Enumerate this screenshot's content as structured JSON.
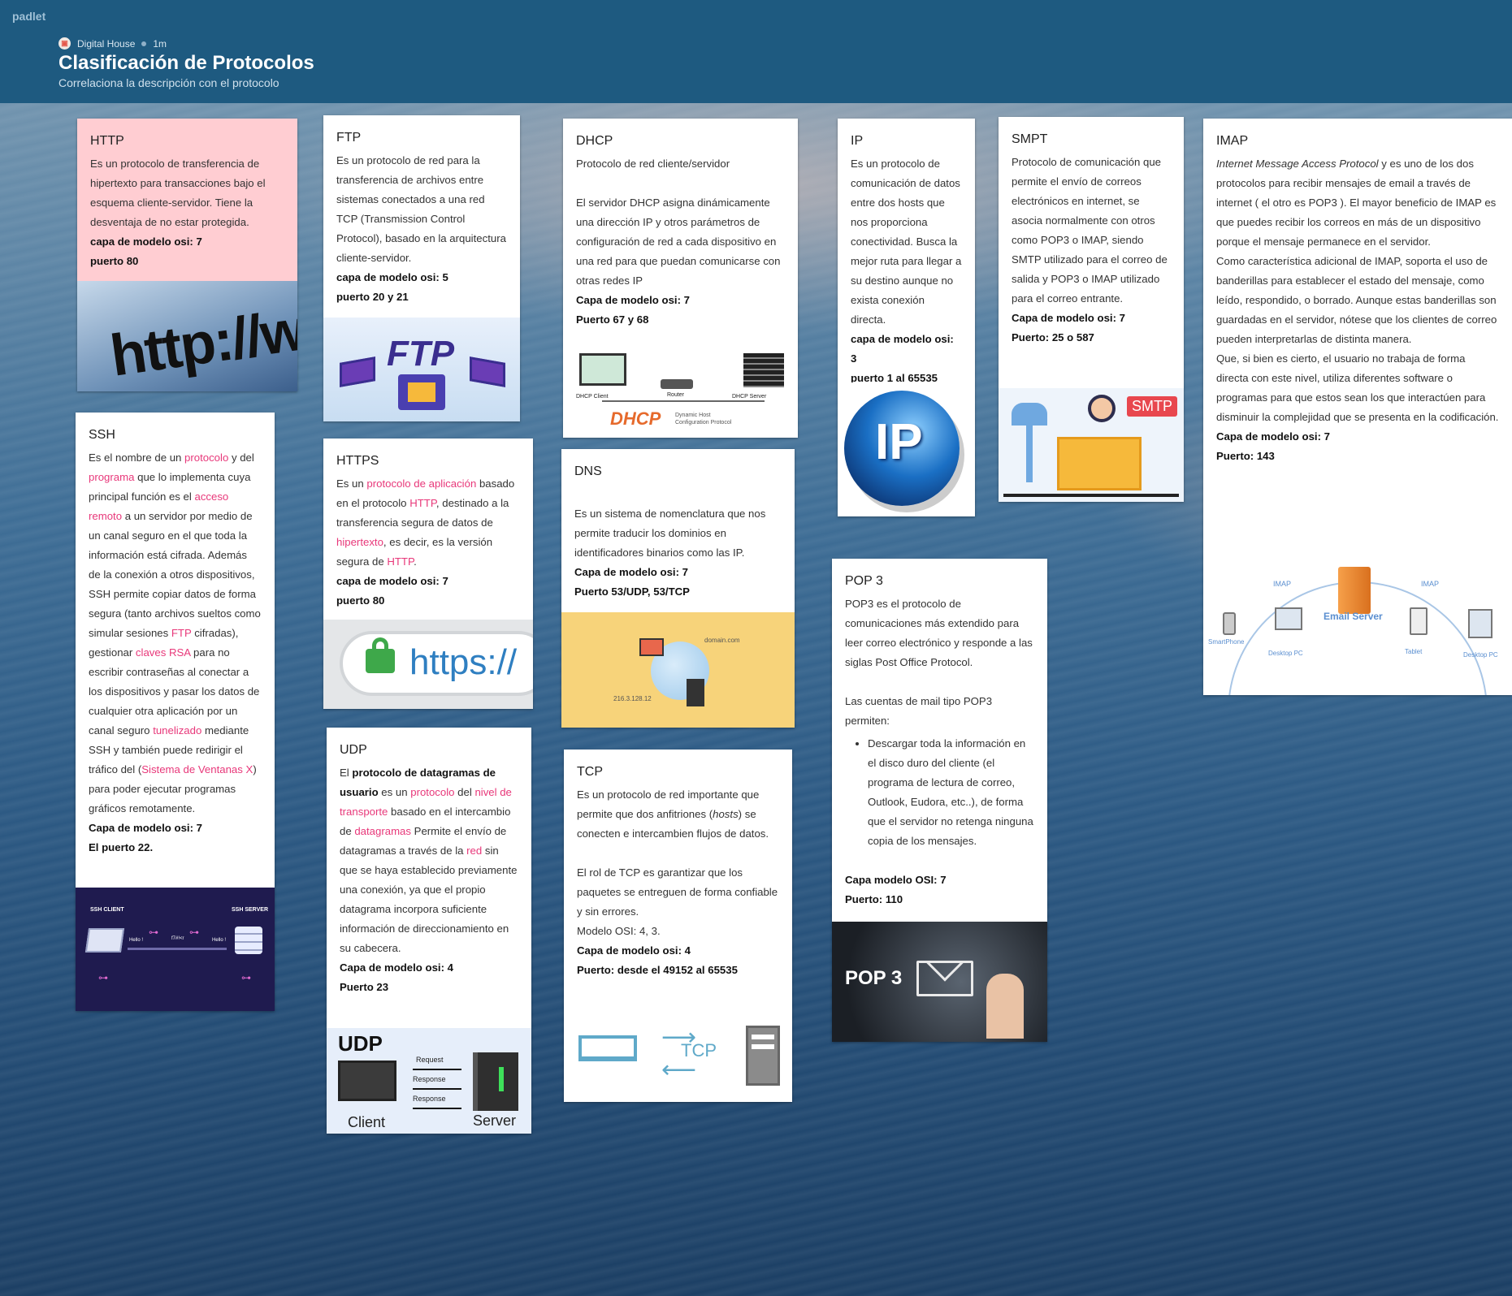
{
  "app": "padlet",
  "header": {
    "author": "Digital House",
    "time": "1m",
    "title": "Clasificación de Protocolos",
    "subtitle": "Correlaciona la descripción con el protocolo"
  },
  "cards": {
    "http": {
      "title": "HTTP",
      "text": "Es un protocolo de transferencia de hipertexto para transacciones bajo el esquema cliente-servidor. Tiene la desventaja de no estar protegida.",
      "layer": "capa de modelo osi: 7",
      "port": "puerto 80",
      "img": "http://www"
    },
    "ftp": {
      "title": "FTP",
      "text": "Es un protocolo de red para la transferencia de archivos entre sistemas conectados a una red TCP (Transmission Control Protocol), basado en la arquitectura cliente-servidor.",
      "layer": "capa de modelo osi: 5",
      "port": "puerto 20 y 21",
      "img": "FTP"
    },
    "dhcp": {
      "title": "DHCP",
      "p1": "Protocolo de red cliente/servidor",
      "p2": "El servidor DHCP asigna dinámicamente una dirección IP y otros parámetros de configuración de red a cada dispositivo en una red para que puedan comunicarse con otras redes IP",
      "layer": "Capa de modelo osi: 7",
      "port": "Puerto 67 y 68",
      "img_logo": "DHCP",
      "img_sub": "Dynamic Host Configuration Protocol",
      "img_client": "DHCP Client",
      "img_router": "Router",
      "img_server": "DHCP Server"
    },
    "ip": {
      "title": "IP",
      "text": "Es un protocolo de comunicación de datos entre dos hosts que nos proporciona conectividad. Busca la mejor ruta para llegar a su destino aunque no exista conexión directa.",
      "layer": "capa de modelo osi: 3",
      "port": "puerto 1 al 65535",
      "img": "IP"
    },
    "smpt": {
      "title": "SMPT",
      "text": "Protocolo de comunicación que permite el envío de correos electrónicos en internet,  se asocia normalmente con otros como POP3 o IMAP, siendo SMTP utilizado para el correo de salida y POP3 o IMAP utilizado para el correo entrante.",
      "layer": "Capa de modelo osi: 7",
      "port": "Puerto: 25 o 587",
      "img": "SMTP"
    },
    "imap": {
      "title": "IMAP",
      "em": "Internet Message Access Protocol",
      "p1": " y es uno de los dos protocolos para recibir mensajes de email a través de internet ( el otro es POP3 ). El mayor beneficio de IMAP es que puedes recibir los correos en más de un dispositivo porque el mensaje permanece en el servidor.",
      "p2": "Como característica adicional de IMAP, soporta el uso de banderillas para establecer el estado del mensaje, como leído, respondido, o borrado. Aunque estas banderillas son guardadas en el servidor, nótese que los clientes de correo pueden interpretarlas de distinta manera.",
      "p3": "Que, si bien es cierto, el usuario no trabaja de forma directa con este nivel, utiliza diferentes software o programas para que estos sean los que interactúen para disminuir la complejidad que se presenta en la codificación.",
      "layer": "Capa de modelo osi: 7",
      "port": "Puerto: 143",
      "img_server": "Email Server",
      "img_imap": "IMAP",
      "img_phone": "SmartPhone",
      "img_pc": "Desktop PC",
      "img_tablet": "Tablet"
    },
    "ssh": {
      "title": "SSH",
      "t1": "Es el nombre de un ",
      "l1": "protocolo",
      "t2": " y del ",
      "l2": "programa",
      "t3": " que lo implementa cuya principal función es el ",
      "l3": "acceso remoto",
      "t4": " a un servidor por medio de un canal seguro en el que toda la información está cifrada. Además de la conexión a otros dispositivos, SSH permite copiar datos de forma segura (tanto archivos sueltos como simular sesiones ",
      "l4": "FTP",
      "t5": " cifradas), gestionar ",
      "l5": "claves RSA",
      "t6": " para no escribir contraseñas al conectar a los dispositivos y pasar los datos de cualquier otra aplicación por un canal seguro ",
      "l6": "tunelizado",
      "t7": " mediante SSH y también puede redirigir el tráfico del (",
      "l7": "Sistema de Ventanas X",
      "t8": ") para poder ejecutar programas gráficos remotamente.",
      "layer": "Capa de modelo osi: 7",
      "port": "El puerto 22.",
      "img_client": "SSH CLIENT",
      "img_server": "SSH SERVER",
      "img_hello": "Hello !",
      "img_enc": "f7#!<r"
    },
    "https": {
      "title": "HTTPS",
      "t1": "Es un ",
      "l1": "protocolo de aplicación",
      "t2": " basado en el protocolo ",
      "l2": "HTTP",
      "t3": ", destinado a la transferencia segura de datos de ",
      "l3": "hipertexto",
      "t4": ", es decir, es la versión segura de ",
      "l4": "HTTP",
      "t5": ".",
      "layer": "capa de modelo osi: 7",
      "port": "puerto 80",
      "img": "https://"
    },
    "dns": {
      "title": "DNS",
      "text": "Es un sistema de nomenclatura que nos permite traducir los dominios en identificadores binarios como las IP.",
      "layer": "Capa de modelo osi: 7",
      "port": "Puerto 53/UDP, 53/TCP",
      "img_domain": "domain.com",
      "img_ip": "216.3.128.12"
    },
    "udp": {
      "title": "UDP",
      "t1": "El ",
      "b1": "protocolo de datagramas de usuario",
      "t2": "  es un ",
      "l1": "protocolo",
      "t3": " del ",
      "l2": "nivel de transporte",
      "t4": " basado en el intercambio de ",
      "l3": "datagramas",
      "t5": " Permite el envío de datagramas a través de la ",
      "l4": "red",
      "t6": " sin que se haya establecido previamente una conexión, ya que el propio datagrama incorpora suficiente información de direccionamiento en su cabecera.",
      "layer": "Capa de modelo osi: 4",
      "port": "Puerto 23",
      "img_title": "UDP",
      "img_req": "Request",
      "img_res": "Response",
      "img_client": "Client",
      "img_server": "Server"
    },
    "tcp": {
      "title": "TCP",
      "t1": "Es un protocolo de red importante que permite que dos anfitriones (",
      "em": "hosts",
      "t2": ") se conecten e intercambien flujos de datos.",
      "p2": "El rol de TCP es garantizar que los paquetes se entreguen de forma confiable y sin errores.",
      "p3": "Modelo OSI: 4, 3.",
      "layer": "Capa de modelo osi: 4",
      "port": "Puerto: desde el 49152 al 65535",
      "img": "TCP"
    },
    "pop3": {
      "title": "POP 3",
      "p1": "POP3 es el protocolo de comunicaciones más extendido para leer correo electrónico y responde a las siglas Post Office Protocol.",
      "p2": "Las cuentas de mail tipo POP3 permiten:",
      "li": "Descargar toda la información en el disco duro del cliente (el programa de lectura de correo, Outlook, Eudora, etc..), de forma que el servidor no retenga ninguna copia de los mensajes.",
      "layer": "Capa modelo OSI: 7",
      "port": "Puerto: 110",
      "img": "POP 3"
    }
  }
}
